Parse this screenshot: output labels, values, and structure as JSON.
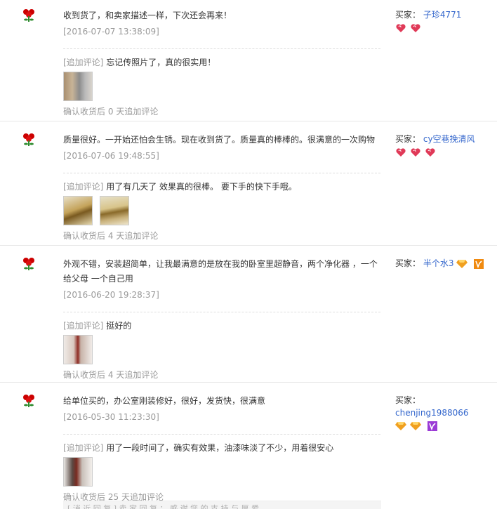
{
  "buyer_label": "买家：",
  "after_prefix": "确认收货后",
  "after_suffix": "天追加评论",
  "append_tag": "[追加评论]",
  "colors": {
    "rose": "#cc0000",
    "heart": "#e03a58",
    "diamond": "#f0a020",
    "vip": "#9b3bd6",
    "vip_orange": "#f08a10",
    "link": "#3366cc"
  },
  "reviews": [
    {
      "content": "收到货了，和卖家描述一样，下次还会再来！",
      "date": "[2016-07-07 13:38:09]",
      "append_text": "忘记传照片了，真的很实用！",
      "days": "0",
      "buyer_name": "子珍4771",
      "badges": [
        "heart-icon",
        "heart-icon"
      ]
    },
    {
      "content": "质量很好。一开始还怕会生锈。现在收到货了。质量真的棒棒的。很满意的一次购物",
      "date": "[2016-07-06 19:48:55]",
      "append_text": "用了有几天了 效果真的很棒。 要下手的快下手哦。",
      "days": "4",
      "buyer_name": "cy空巷挽清风",
      "badges": [
        "heart-icon",
        "heart-icon",
        "heart-icon"
      ]
    },
    {
      "content": "外观不错，安装超简单，让我最满意的是放在我的卧室里超静音，两个净化器 ，一个给父母 一个自己用",
      "date": "[2016-06-20 19:28:37]",
      "append_text": "挺好的",
      "days": "4",
      "buyer_name": "半个水3",
      "badges": [
        "diamond-icon",
        "vip-icon"
      ]
    },
    {
      "content": "给单位买的，办公室刚装修好，很好，发货快，很满意",
      "date": "[2016-05-30 11:23:30]",
      "append_text": "用了一段时间了，确实有效果，油漆味淡了不少，用着很安心",
      "days": "25",
      "buyer_name": "chenjing1988066",
      "badges": [
        "diamond-icon",
        "diamond-icon",
        "vip-icon"
      ]
    }
  ],
  "bottom_partial_text": "[ 消 近 回 复 ] 卖 家 回 复 ： 感 谢 您 的 支 持 与 厚 爱 ……"
}
